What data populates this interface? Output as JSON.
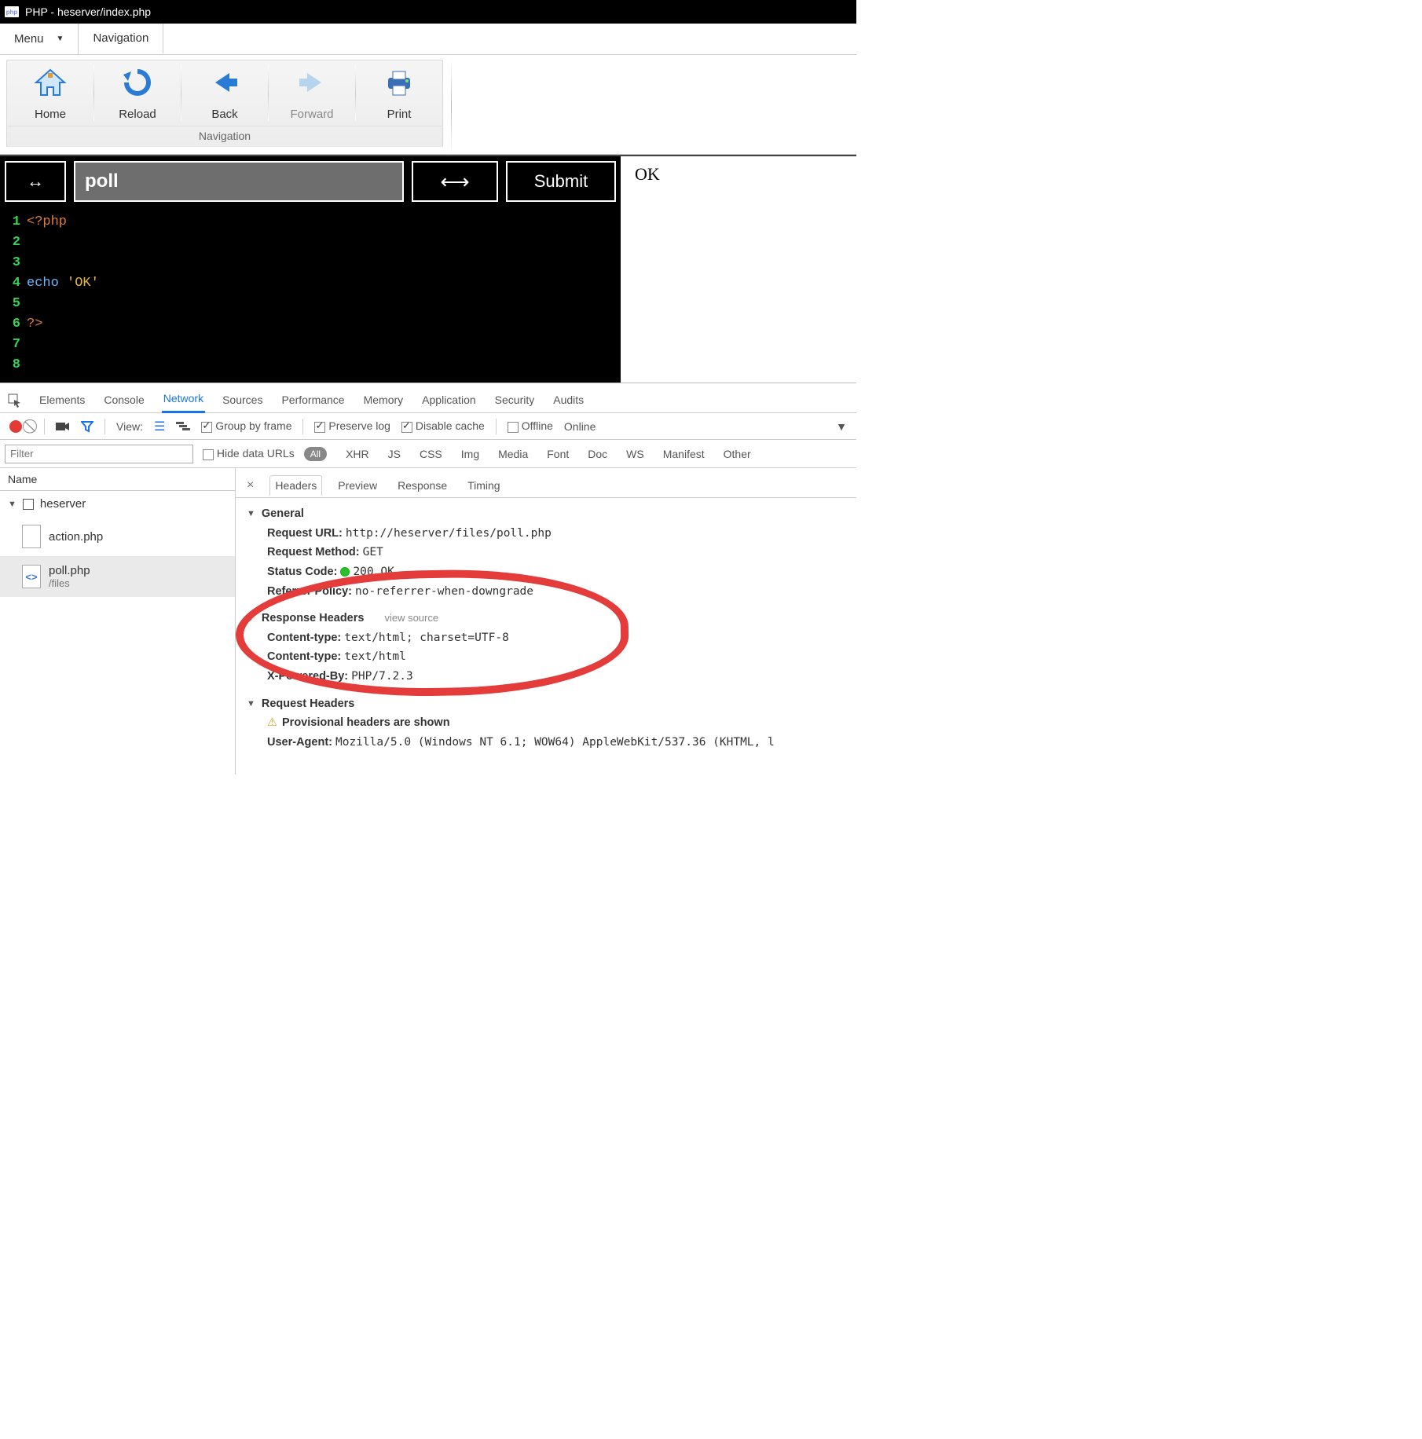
{
  "window": {
    "title": "PHP - heserver/index.php",
    "icon_label": "php"
  },
  "menubar": {
    "menu": "Menu",
    "navigation": "Navigation"
  },
  "ribbon": {
    "group_label": "Navigation",
    "items": [
      {
        "label": "Home"
      },
      {
        "label": "Reload"
      },
      {
        "label": "Back"
      },
      {
        "label": "Forward",
        "disabled": true
      },
      {
        "label": "Print"
      }
    ]
  },
  "editor": {
    "tab_name": "poll",
    "submit": "Submit",
    "lines": [
      {
        "n": 1,
        "html": "<span class='tok-tag'>&lt;?php</span>"
      },
      {
        "n": 2,
        "html": ""
      },
      {
        "n": 3,
        "html": ""
      },
      {
        "n": 4,
        "html": "<span class='tok-kw'>echo</span> <span class='tok-str'>'OK'</span>;"
      },
      {
        "n": 5,
        "html": ""
      },
      {
        "n": 6,
        "html": "<span class='tok-tag'>?&gt;</span>"
      },
      {
        "n": 7,
        "html": ""
      },
      {
        "n": 8,
        "html": ""
      }
    ]
  },
  "output": {
    "text": "OK"
  },
  "devtools": {
    "tabs": [
      "Elements",
      "Console",
      "Network",
      "Sources",
      "Performance",
      "Memory",
      "Application",
      "Security",
      "Audits"
    ],
    "active_tab": "Network",
    "toolbar": {
      "view_label": "View:",
      "group_by_frame": "Group by frame",
      "preserve_log": "Preserve log",
      "disable_cache": "Disable cache",
      "offline": "Offline",
      "online": "Online"
    },
    "filterbar": {
      "placeholder": "Filter",
      "hide_data_urls": "Hide data URLs",
      "types": [
        "All",
        "XHR",
        "JS",
        "CSS",
        "Img",
        "Media",
        "Font",
        "Doc",
        "WS",
        "Manifest",
        "Other"
      ]
    },
    "request_list": {
      "header": "Name",
      "domain": "heserver",
      "items": [
        {
          "name": "action.php",
          "sub": "",
          "selected": false,
          "php": false
        },
        {
          "name": "poll.php",
          "sub": "/files",
          "selected": true,
          "php": true
        }
      ]
    },
    "details": {
      "tabs": [
        "Headers",
        "Preview",
        "Response",
        "Timing"
      ],
      "active": "Headers",
      "general": {
        "title": "General",
        "request_url_label": "Request URL:",
        "request_url": "http://heserver/files/poll.php",
        "request_method_label": "Request Method:",
        "request_method": "GET",
        "status_code_label": "Status Code:",
        "status_code": "200 OK",
        "referrer_policy_label": "Referrer Policy:",
        "referrer_policy": "no-referrer-when-downgrade"
      },
      "response_headers": {
        "title": "Response Headers",
        "view_source": "view source",
        "rows": [
          {
            "k": "Content-type:",
            "v": "text/html; charset=UTF-8"
          },
          {
            "k": "Content-type:",
            "v": "text/html"
          },
          {
            "k": "X-Powered-By:",
            "v": "PHP/7.2.3"
          }
        ]
      },
      "request_headers": {
        "title": "Request Headers",
        "provisional": "Provisional headers are shown",
        "user_agent_label": "User-Agent:",
        "user_agent": "Mozilla/5.0 (Windows NT 6.1; WOW64) AppleWebKit/537.36 (KHTML, l"
      }
    }
  }
}
